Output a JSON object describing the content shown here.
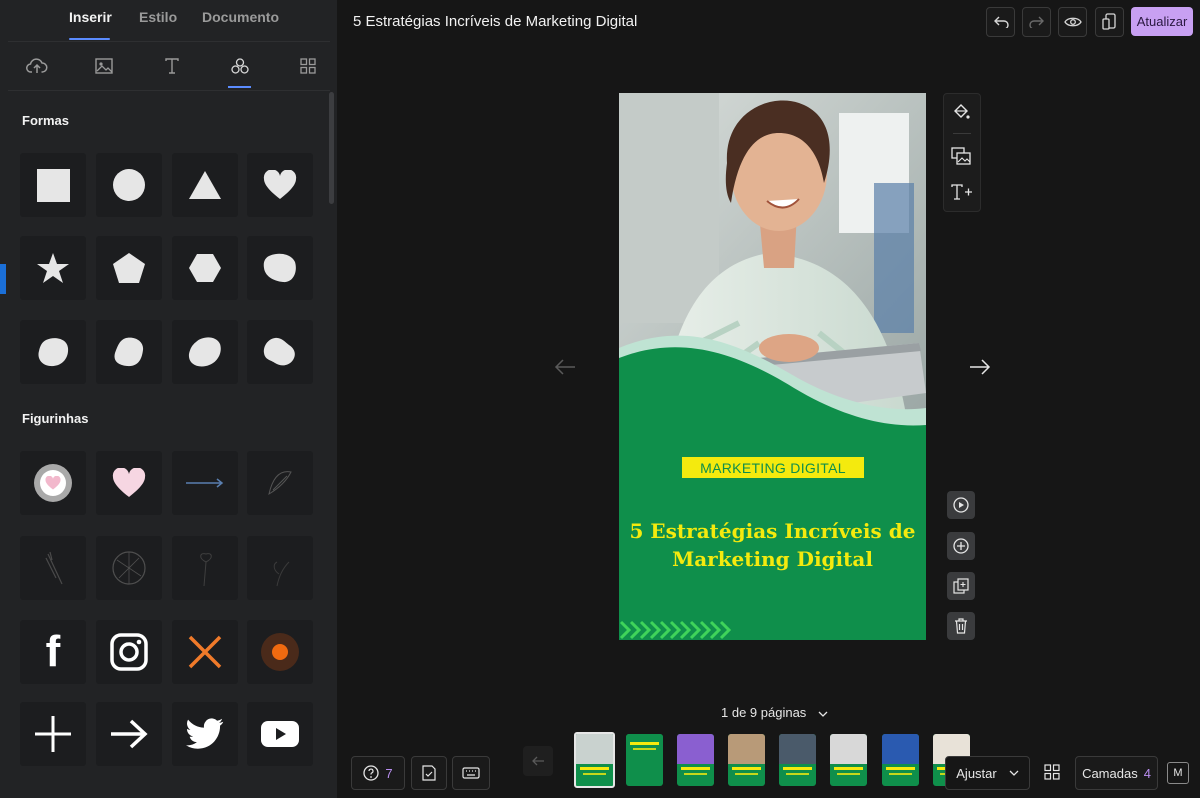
{
  "sidebar": {
    "tabs": [
      "Inserir",
      "Estilo",
      "Documento"
    ],
    "active_tab": "Inserir",
    "categories": [
      "upload-icon",
      "image-icon",
      "text-icon",
      "shapes-icon",
      "grid-icon"
    ],
    "active_category": "shapes-icon",
    "sections": {
      "forms_title": "Formas",
      "stickers_title": "Figurinhas"
    }
  },
  "header": {
    "title": "5 Estratégias Incríveis de Marketing Digital",
    "update_label": "Atualizar"
  },
  "canvas": {
    "badge_text": "MARKETING DIGITAL",
    "headline": "5 Estratégias Incríveis de Marketing Digital",
    "colors": {
      "background": "#0f8f4b",
      "accent": "#f4ea0e"
    }
  },
  "footer": {
    "page_count": "1 de 9 páginas",
    "help_count": "7",
    "fit_label": "Ajustar",
    "layers_label": "Camadas",
    "layers_count": "4",
    "m_label": "M"
  },
  "colors": {
    "accent_purple": "#c8a0f2",
    "tab_blue": "#5b8cff"
  }
}
